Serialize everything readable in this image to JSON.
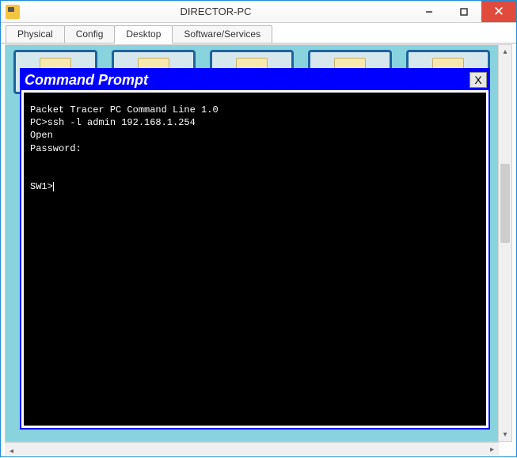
{
  "window": {
    "title": "DIRECTOR-PC"
  },
  "tabs": [
    {
      "label": "Physical"
    },
    {
      "label": "Config"
    },
    {
      "label": "Desktop"
    },
    {
      "label": "Software/Services"
    }
  ],
  "cmd": {
    "title": "Command Prompt",
    "close_label": "X",
    "lines": {
      "l0": "Packet Tracer PC Command Line 1.0",
      "l1": "PC>ssh -l admin 192.168.1.254",
      "l2": "Open",
      "l3": "Password:",
      "l4": "",
      "l5": "",
      "l6": "SW1>"
    }
  }
}
